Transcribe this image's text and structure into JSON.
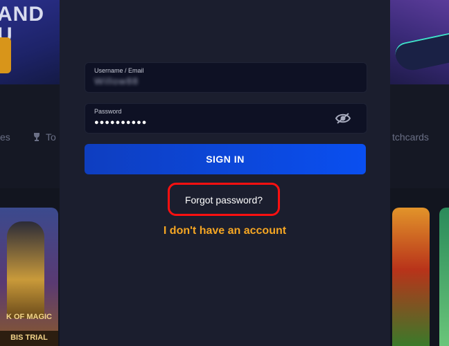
{
  "background": {
    "banner_text": "AND U",
    "nav": {
      "left_partial": "es",
      "left_item": "To",
      "right_partial": "tchcards"
    },
    "game_left": {
      "title": "K OF MAGIC",
      "subtitle": "BIS TRIAL"
    }
  },
  "login": {
    "username": {
      "label": "Username / Email",
      "value": "Willow88"
    },
    "password": {
      "label": "Password",
      "value": "●●●●●●●●●●"
    },
    "signin_label": "SIGN IN",
    "forgot_label": "Forgot password?",
    "no_account_label": "I don't have an account"
  },
  "colors": {
    "modal_bg": "#1b1e2e",
    "accent_blue": "#0a4ff0",
    "link_orange": "#f5a623",
    "highlight_red": "#ff1010"
  }
}
